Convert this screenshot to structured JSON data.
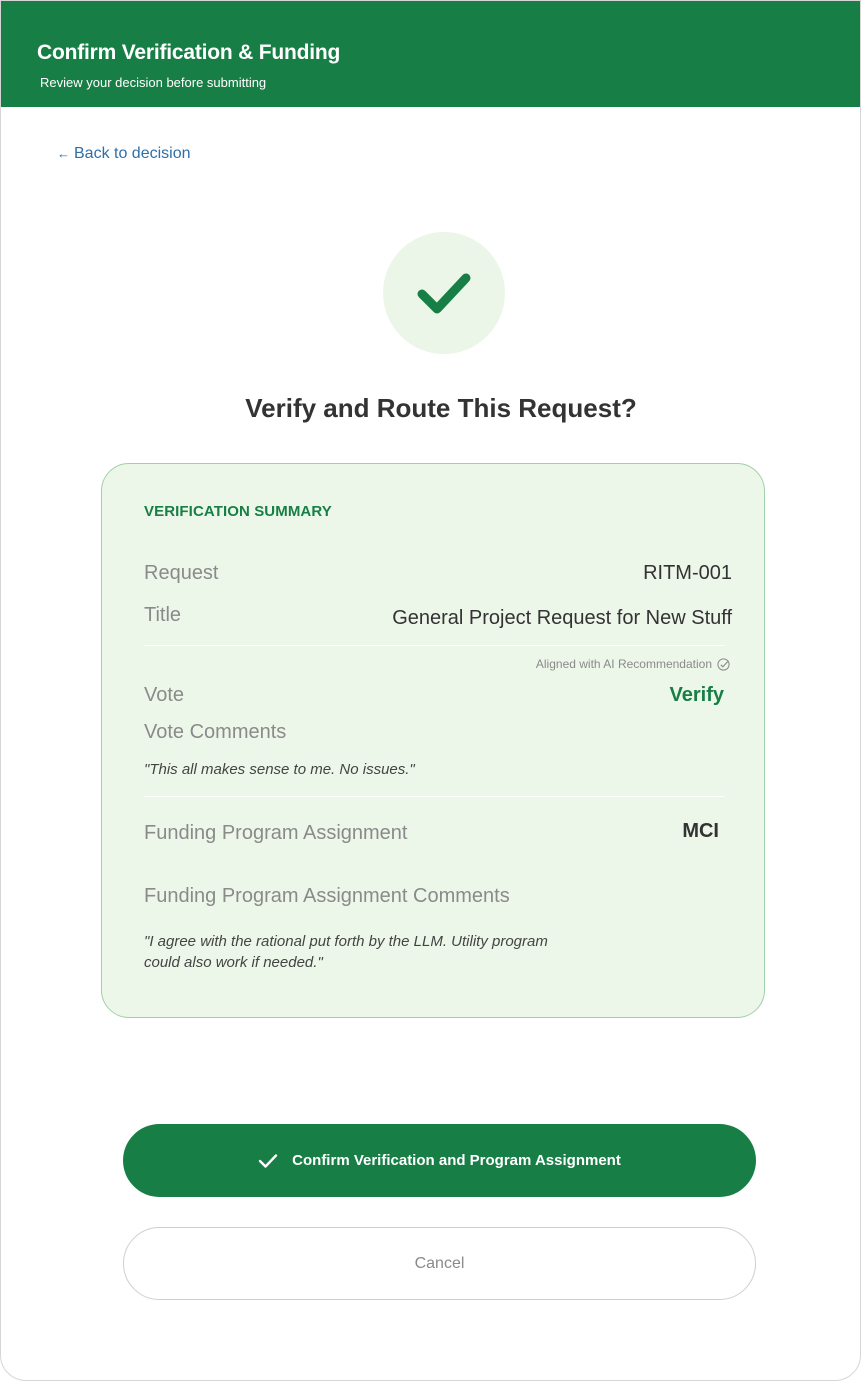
{
  "header": {
    "title": "Confirm Verification & Funding",
    "subtitle": "Review your decision before submitting"
  },
  "nav": {
    "back_arrow": "←",
    "back_label": "Back to decision"
  },
  "icons": {
    "status": "check-icon",
    "ai_aligned": "check-circle-icon",
    "confirm": "check-icon",
    "back": "arrow-left-icon"
  },
  "question": "Verify and Route This Request?",
  "summary": {
    "heading": "VERIFICATION SUMMARY",
    "request_label": "Request",
    "request_value": "RITM-001",
    "title_label": "Title",
    "title_value": "General Project Request for New Stuff",
    "ai_note": "Aligned with AI Recommendation",
    "vote_label": "Vote",
    "vote_value": "Verify",
    "vote_comments_label": "Vote Comments",
    "vote_comment": "\"This all makes sense to me. No issues.\"",
    "program_label": "Funding Program Assignment",
    "program_value": "MCI",
    "program_comments_label": "Funding Program Assignment Comments",
    "program_comment_line1": "\"I agree with the rational put forth by the LLM. Utility program",
    "program_comment_line2": "could also work if needed.\""
  },
  "actions": {
    "confirm_label": "Confirm Verification and Program Assignment",
    "cancel_label": "Cancel"
  },
  "colors": {
    "brand_green": "#177f45",
    "card_background": "#edf7e9",
    "card_border": "#9fd0a7",
    "link_blue": "#2e6fa8"
  }
}
